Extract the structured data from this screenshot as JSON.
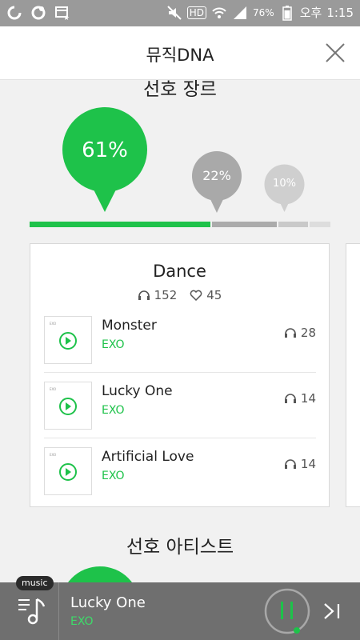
{
  "status_bar": {
    "battery": "76%",
    "time_period": "오후",
    "time": "1:15",
    "network": "HD",
    "icons": [
      "app-o-icon",
      "settings-ring-icon",
      "calendar-star-icon",
      "mute-icon",
      "hd-icon",
      "wifi-icon",
      "signal-icon"
    ]
  },
  "header": {
    "title": "뮤직DNA",
    "close_icon": "close-icon"
  },
  "genre_section": {
    "title": "선호 장르",
    "bubbles": [
      {
        "label": "61%",
        "value": 61,
        "color": "#1ec24a"
      },
      {
        "label": "22%",
        "value": 22,
        "color": "#a9a9a9"
      },
      {
        "label": "10%",
        "value": 10,
        "color": "#cfcfcf"
      }
    ],
    "bar": {
      "segments": [
        {
          "value": 61,
          "color": "#1ec24a"
        },
        {
          "value": 22,
          "color": "#ababab"
        },
        {
          "value": 10,
          "color": "#c9c9c9"
        },
        {
          "value": 7,
          "color": "#dddddd"
        }
      ]
    },
    "card": {
      "genre": "Dance",
      "listens": "152",
      "likes": "45",
      "tracks": [
        {
          "name": "Monster",
          "artist": "EXO",
          "plays": "28"
        },
        {
          "name": "Lucky One",
          "artist": "EXO",
          "plays": "14"
        },
        {
          "name": "Artificial Love",
          "artist": "EXO",
          "plays": "14"
        }
      ]
    }
  },
  "artist_section": {
    "title": "선호 아티스트"
  },
  "player": {
    "badge": "music",
    "title": "Lucky One",
    "artist": "EXO",
    "progress": 0.02,
    "accent": "#1ec24a"
  }
}
